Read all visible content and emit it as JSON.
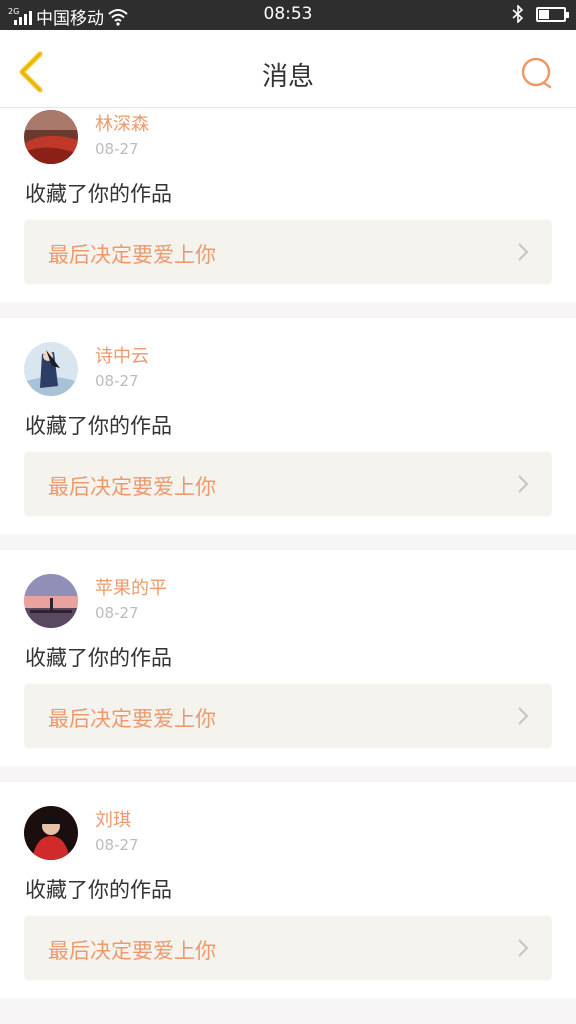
{
  "status_bar": {
    "carrier": "中国移动",
    "network": "2G",
    "time": "08:53",
    "battery_level": 0.4
  },
  "nav": {
    "title": "消息",
    "accent_color": "#f5c518",
    "search_color": "#ec9a6d"
  },
  "messages": [
    {
      "username": "林深森",
      "date": "08-27",
      "action": "收藏了你的作品",
      "work_title": "最后决定要爱上你"
    },
    {
      "username": "诗中云",
      "date": "08-27",
      "action": "收藏了你的作品",
      "work_title": "最后决定要爱上你"
    },
    {
      "username": "苹果的平",
      "date": "08-27",
      "action": "收藏了你的作品",
      "work_title": "最后决定要爱上你"
    },
    {
      "username": "刘琪",
      "date": "08-27",
      "action": "收藏了你的作品",
      "work_title": "最后决定要爱上你"
    }
  ]
}
